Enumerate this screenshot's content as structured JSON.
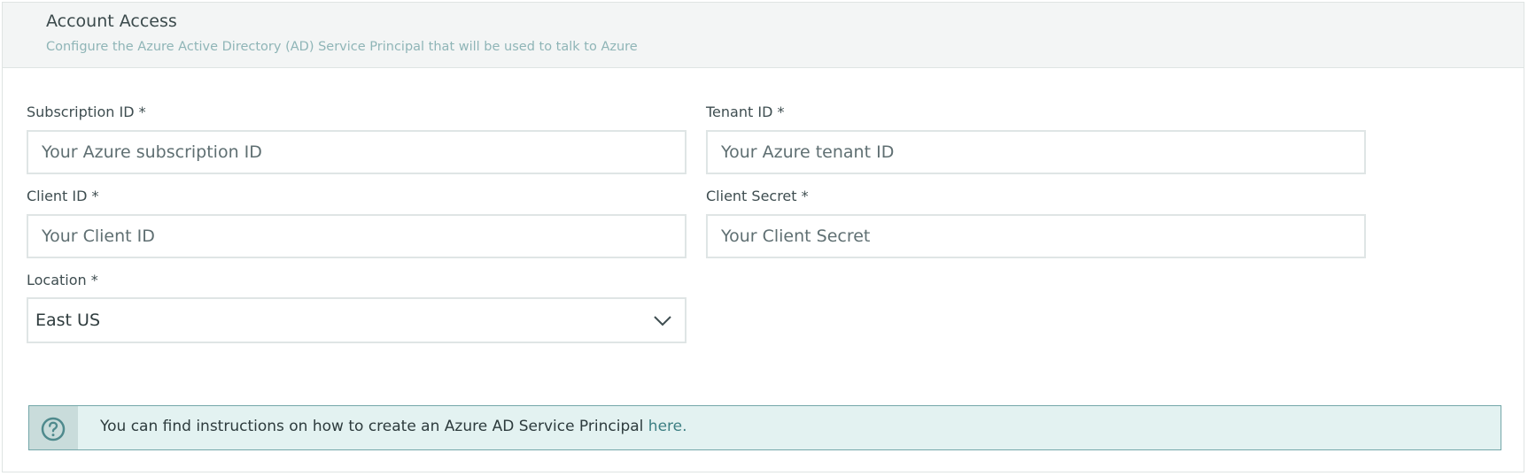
{
  "header": {
    "title": "Account Access",
    "subtitle": "Configure the Azure Active Directory (AD) Service Principal that will be used to talk to Azure"
  },
  "fields": {
    "subscription_id": {
      "label": "Subscription ID *",
      "placeholder": "Your Azure subscription ID",
      "value": ""
    },
    "tenant_id": {
      "label": "Tenant ID *",
      "placeholder": "Your Azure tenant ID",
      "value": ""
    },
    "client_id": {
      "label": "Client ID *",
      "placeholder": "Your Client ID",
      "value": ""
    },
    "client_secret": {
      "label": "Client Secret *",
      "placeholder": "Your Client Secret",
      "value": ""
    },
    "location": {
      "label": "Location *",
      "selected": "East US"
    }
  },
  "info": {
    "icon": "help-circle-icon",
    "text": "You can find instructions on how to create an Azure AD Service Principal",
    "link_text": "here."
  },
  "colors": {
    "header_bg": "#f3f5f5",
    "subtitle": "#8fb5b7",
    "info_bg": "#e3f2f1",
    "info_border": "#74a7a9",
    "link": "#3d7f83"
  }
}
